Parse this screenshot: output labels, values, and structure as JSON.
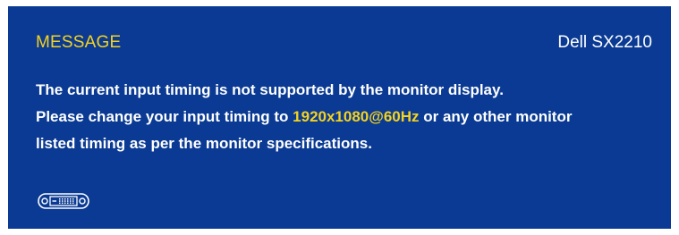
{
  "osd": {
    "title": "MESSAGE",
    "model": "Dell SX2210",
    "lines": [
      {
        "text": "The current input timing is not supported by the monitor display."
      },
      {
        "before": "Please change your input timing to ",
        "highlight": "1920x1080@60Hz",
        "after": " or any other monitor"
      },
      {
        "text": "listed timing as per the monitor specifications."
      }
    ],
    "input_icon": "dvi-connector-icon",
    "colors": {
      "background": "#0a3a93",
      "accent": "#f4d21f",
      "text": "#ffffff"
    }
  }
}
